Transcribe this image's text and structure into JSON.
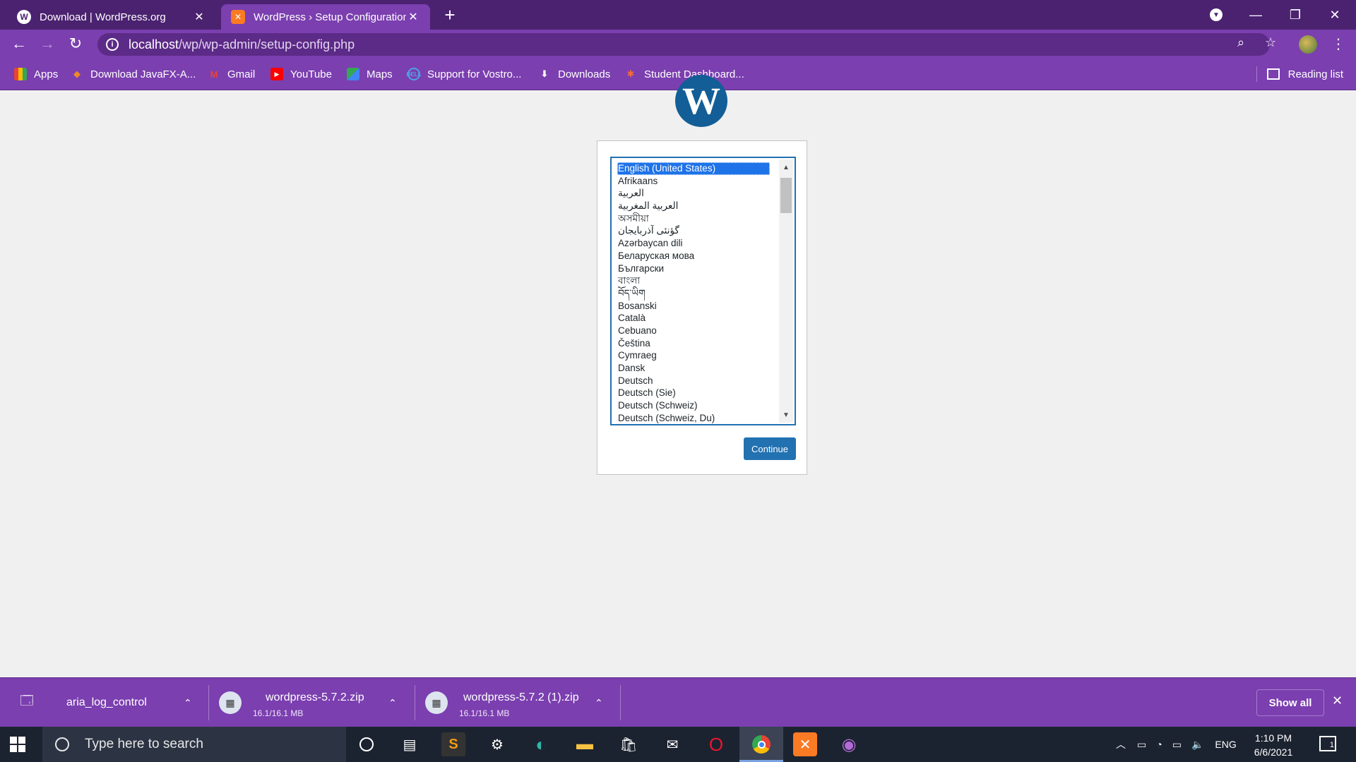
{
  "browser": {
    "tabs": [
      {
        "title": "Download | WordPress.org",
        "active": false
      },
      {
        "title": "WordPress › Setup Configuration",
        "active": true
      }
    ],
    "address": {
      "host": "localhost",
      "path": "/wp/wp-admin/setup-config.php"
    },
    "bookmarks": [
      {
        "label": "Apps",
        "icon": "apps-grid-icon"
      },
      {
        "label": "Download JavaFX-A...",
        "icon": "javafx-icon"
      },
      {
        "label": "Gmail",
        "icon": "gmail-icon"
      },
      {
        "label": "YouTube",
        "icon": "youtube-icon"
      },
      {
        "label": "Maps",
        "icon": "maps-icon"
      },
      {
        "label": "Support for Vostro...",
        "icon": "dell-icon"
      },
      {
        "label": "Downloads",
        "icon": "download-arrow-icon"
      },
      {
        "label": "Student Dashboard...",
        "icon": "student-dashboard-icon"
      }
    ],
    "reading_list": "Reading list"
  },
  "setup": {
    "languages": [
      "English (United States)",
      "Afrikaans",
      "العربية",
      "العربية المغربية",
      "অসমীয়া",
      "گؤنئی آذربایجان",
      "Azərbaycan dili",
      "Беларуская мова",
      "Български",
      "বাংলা",
      "བོད་ཡིག",
      "Bosanski",
      "Català",
      "Cebuano",
      "Čeština",
      "Cymraeg",
      "Dansk",
      "Deutsch",
      "Deutsch (Sie)",
      "Deutsch (Schweiz)",
      "Deutsch (Schweiz, Du)"
    ],
    "selected": "English (United States)",
    "continue_label": "Continue"
  },
  "downloads": {
    "items": [
      {
        "name": "aria_log_control",
        "size": ""
      },
      {
        "name": "wordpress-5.7.2.zip",
        "size": "16.1/16.1 MB"
      },
      {
        "name": "wordpress-5.7.2 (1).zip",
        "size": "16.1/16.1 MB"
      }
    ],
    "show_all": "Show all"
  },
  "taskbar": {
    "search_placeholder": "Type here to search",
    "language": "ENG",
    "time": "1:10 PM",
    "date": "6/6/2021",
    "notifications": "1"
  },
  "colors": {
    "chrome_dark": "#4b2270",
    "chrome": "#7b3fb0",
    "wp_blue": "#2271b1",
    "page_bg": "#f0f0f1"
  }
}
